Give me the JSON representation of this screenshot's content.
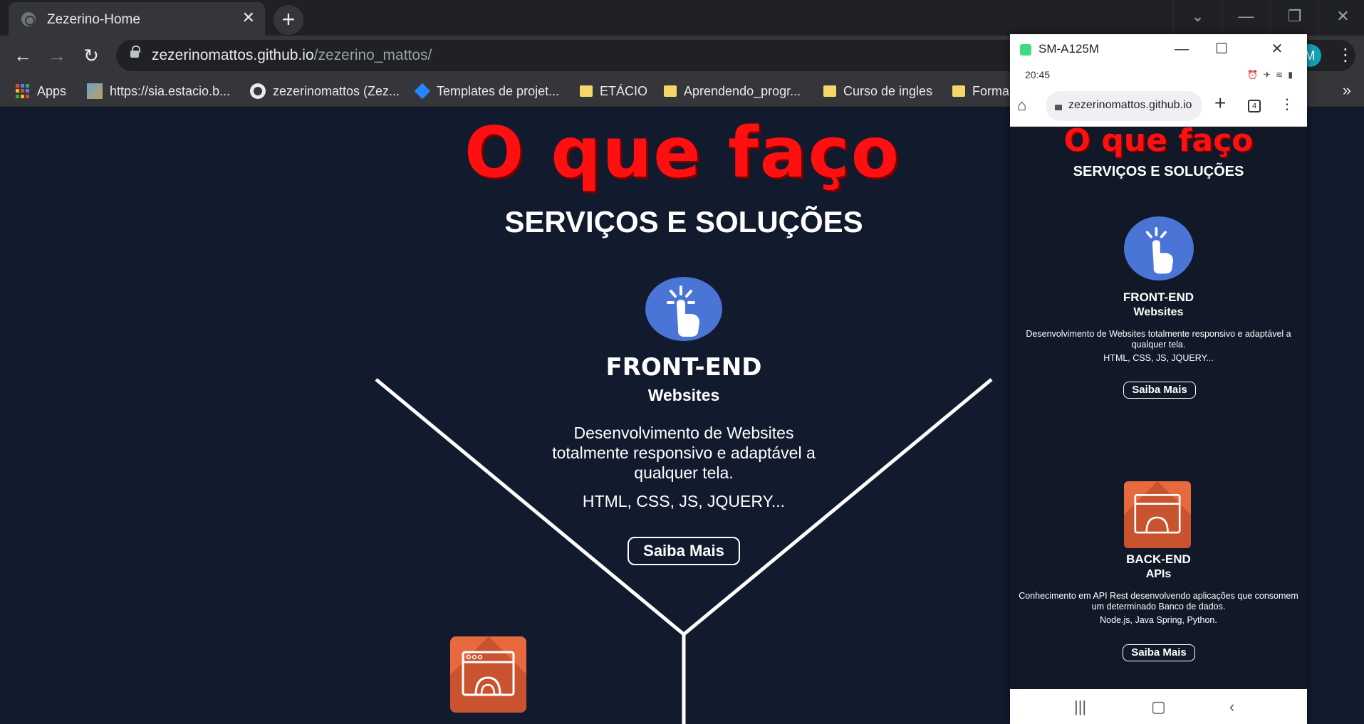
{
  "browser": {
    "tab_title": "Zezerino-Home",
    "url_host": "zezerinomattos.github.io",
    "url_path": "/zezerino_mattos/",
    "profile_initial": "M",
    "bookmarks": [
      {
        "label": "Apps",
        "icon": "apps-grid-icon"
      },
      {
        "label": "https://sia.estacio.b...",
        "icon": "sia-icon"
      },
      {
        "label": "zezerinomattos (Zez...",
        "icon": "github-icon"
      },
      {
        "label": "Templates de projet...",
        "icon": "jira-icon"
      },
      {
        "label": "ETÁCIO",
        "icon": "folder-icon"
      },
      {
        "label": "Aprendendo_progr...",
        "icon": "folder-icon"
      },
      {
        "label": "Curso de ingles",
        "icon": "folder-icon"
      },
      {
        "label": "Forma",
        "icon": "folder-icon"
      }
    ]
  },
  "page": {
    "title": "O que faço",
    "subtitle": "SERVIÇOS E SOLUÇÕES",
    "frontend": {
      "name": "FRONT-END",
      "sub": "Websites",
      "desc": "Desenvolvimento de Websites totalmente responsivo e adaptável a qualquer tela.",
      "tech": "HTML, CSS, JS, JQUERY...",
      "button": "Saiba Mais"
    }
  },
  "phone": {
    "window_title": "SM-A125M",
    "time": "20:45",
    "url": "zezerinomattos.github.io",
    "tab_count": "4",
    "title": "O que faço",
    "subtitle": "SERVIÇOS E SOLUÇÕES",
    "frontend": {
      "name": "FRONT-END",
      "sub": "Websites",
      "desc": "Desenvolvimento de Websites totalmente responsivo e adaptável a qualquer tela.",
      "tech": "HTML, CSS, JS, JQUERY...",
      "button": "Saiba Mais"
    },
    "backend": {
      "name": "BACK-END",
      "sub": "APIs",
      "desc": "Conhecimento em API Rest desenvolvendo aplicações que consomem um determinado Banco de dados.",
      "tech": "Node.js, Java Spring, Python.",
      "button": "Saiba Mais"
    }
  },
  "colors": {
    "page_bg": "#121a2e",
    "title_red": "#ff1010",
    "frontend_icon": "#4a74d6",
    "backend_icon": "#e8693e"
  }
}
